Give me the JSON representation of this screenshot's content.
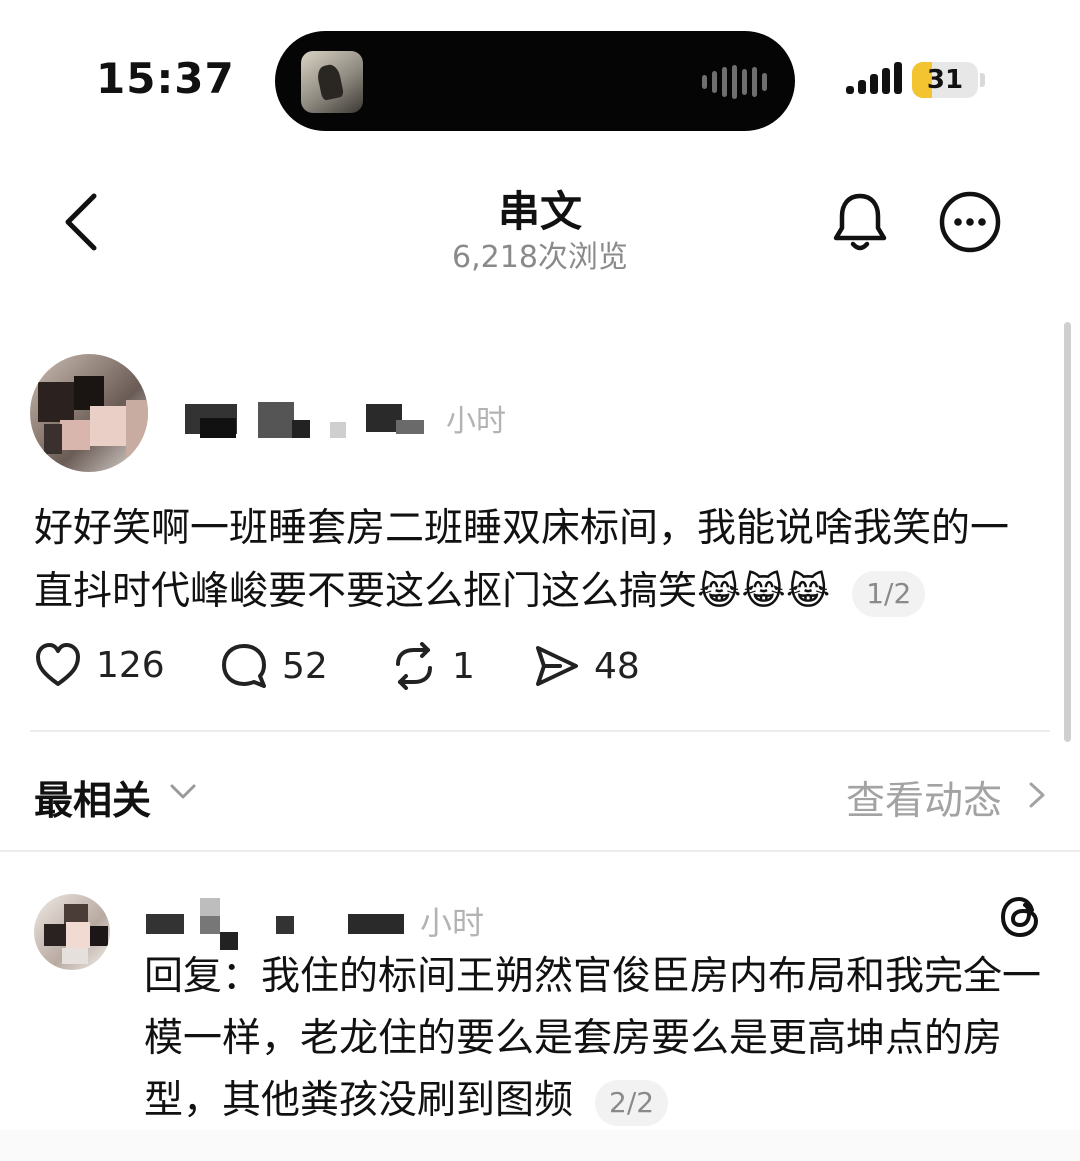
{
  "status_bar": {
    "time": "15:37",
    "battery": "31",
    "battery_level": 0.31
  },
  "header": {
    "title": "串文",
    "views": "6,218次浏览"
  },
  "post": {
    "time": "小时",
    "text": "好好笑啊一班睡套房二班睡双床标间，我能说啥我笑的一直抖时代峰峻要不要这么抠门这么搞笑",
    "emoji": "😹😹😹",
    "page_indicator": "1/2",
    "likes": "126",
    "comments": "52",
    "reposts": "1",
    "shares": "48"
  },
  "sort": {
    "label": "最相关",
    "activity_link": "查看动态"
  },
  "reply": {
    "time": "小时",
    "text": "回复：我住的标间王朔然官俊臣房内布局和我完全一模一样，老龙住的要么是套房要么是更高坤点的房型，其他粪孩没刷到图频",
    "page_indicator": "2/2"
  },
  "icons": [
    "chevron-left-icon",
    "bell-icon",
    "more-icon",
    "heart-icon",
    "comment-icon",
    "repost-icon",
    "share-icon",
    "chevron-down-icon",
    "chevron-right-icon",
    "threads-logo-icon"
  ],
  "colors": {
    "battery_accent": "#f4c430",
    "muted_text": "#8a8a8a"
  }
}
